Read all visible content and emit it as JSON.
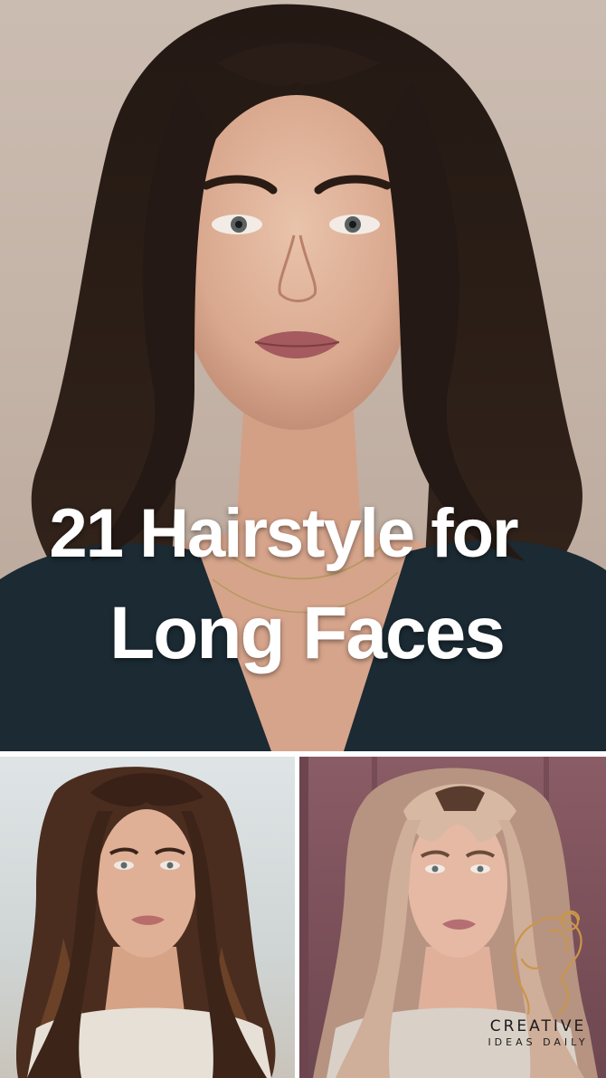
{
  "headline": {
    "line1": "21 Hairstyle for",
    "line2": "Long Faces"
  },
  "photos": {
    "hero": "hero-portrait",
    "bottom_left": "brunette-balayage-waves",
    "bottom_right": "blonde-balayage-curtain-bangs"
  },
  "watermark": {
    "line1": "CREATIVE",
    "line2": "IDEAS DAILY",
    "color": "#c9964a"
  },
  "colors": {
    "headline_text": "#ffffff",
    "hero_background": "#c4b3a7",
    "hair_dark": "#1f1611",
    "blazer": "#1b2a33"
  }
}
